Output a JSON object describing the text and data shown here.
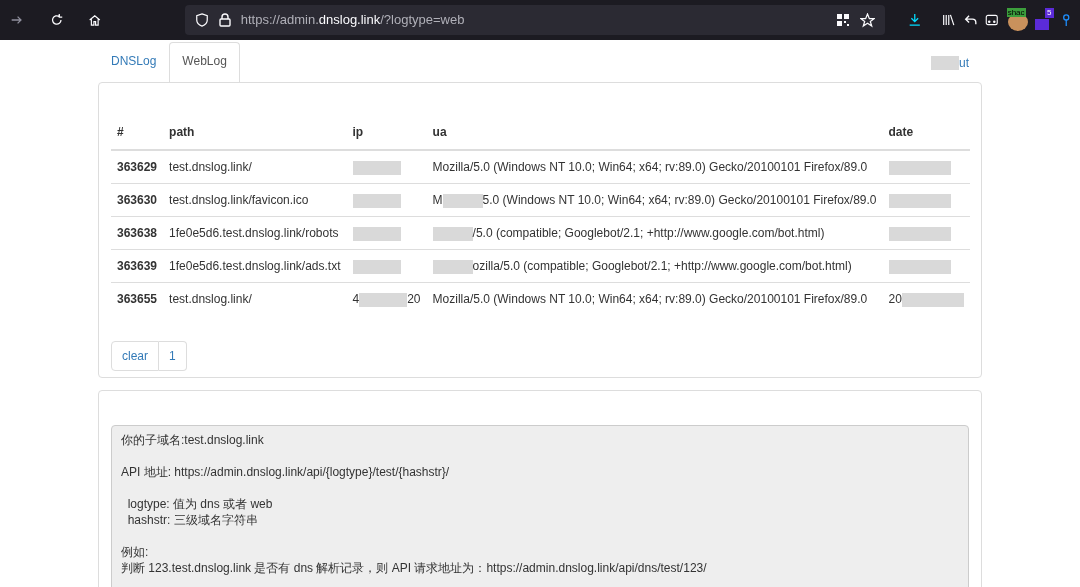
{
  "browser": {
    "url_host_prefix": "https://admin.",
    "url_host": "dnslog.link",
    "url_rest": "/?logtype=web",
    "extension_badge": "5",
    "extension_label": "shac"
  },
  "tabs": [
    {
      "label": "DNSLog",
      "selected": false
    },
    {
      "label": "WebLog",
      "selected": true
    }
  ],
  "account_link": [
    {
      "kind": "redacted"
    },
    {
      "kind": "text",
      "text": "ut"
    }
  ],
  "table": {
    "columns": [
      "#",
      "path",
      "ip",
      "ua",
      "date"
    ],
    "rows": [
      {
        "id": "363629",
        "path": "test.dnslog.link/",
        "ip": [
          {
            "kind": "redacted"
          }
        ],
        "ua": [
          {
            "kind": "text",
            "text": "Mozilla/5.0 (Windows NT 10.0; Win64; x64; rv:89.0) Gecko/20100101 Firefox/89.0"
          }
        ],
        "date": [
          {
            "kind": "redacted"
          }
        ]
      },
      {
        "id": "363630",
        "path": "test.dnslog.link/favicon.ico",
        "ip": [
          {
            "kind": "redacted"
          }
        ],
        "ua": [
          {
            "kind": "text",
            "text": "M"
          },
          {
            "kind": "redacted"
          },
          {
            "kind": "text",
            "text": "5.0 (Windows NT 10.0; Win64; x64; rv:89.0) Gecko/20100101 Firefox/89.0"
          }
        ],
        "date": [
          {
            "kind": "redacted"
          }
        ]
      },
      {
        "id": "363638",
        "path": "1fe0e5d6.test.dnslog.link/robots",
        "ip": [
          {
            "kind": "redacted"
          }
        ],
        "ua": [
          {
            "kind": "redacted"
          },
          {
            "kind": "text",
            "text": "/5.0 (compatible; Googlebot/2.1; +http://www.google.com/bot.html)"
          }
        ],
        "date": [
          {
            "kind": "redacted"
          }
        ]
      },
      {
        "id": "363639",
        "path": "1fe0e5d6.test.dnslog.link/ads.txt",
        "ip": [
          {
            "kind": "redacted"
          }
        ],
        "ua": [
          {
            "kind": "redacted"
          },
          {
            "kind": "text",
            "text": "ozilla/5.0 (compatible; Googlebot/2.1; +http://www.google.com/bot.html)"
          }
        ],
        "date": [
          {
            "kind": "redacted"
          }
        ]
      },
      {
        "id": "363655",
        "path": "test.dnslog.link/",
        "ip": [
          {
            "kind": "text",
            "text": "4"
          },
          {
            "kind": "redacted"
          },
          {
            "kind": "text",
            "text": "20"
          }
        ],
        "ua": [
          {
            "kind": "text",
            "text": "Mozilla/5.0 (Windows NT 10.0; Win64; x64; rv:89.0) Gecko/20100101 Firefox/89.0"
          }
        ],
        "date": [
          {
            "kind": "text",
            "text": "20"
          },
          {
            "kind": "redacted"
          }
        ]
      }
    ]
  },
  "pagination": [
    "clear",
    "1"
  ],
  "info_paragraphs": [
    [
      "你的子域名:test.dnslog.link"
    ],
    [
      "API 地址: https://admin.dnslog.link/api/{logtype}/test/{hashstr}/"
    ],
    [
      "  logtype: 值为 dns 或者 web",
      "  hashstr: 三级域名字符串"
    ],
    [
      "例如:",
      "判断 123.test.dnslog.link 是否有 dns 解析记录，则 API 请求地址为：https://admin.dnslog.link/api/dns/test/123/"
    ]
  ]
}
